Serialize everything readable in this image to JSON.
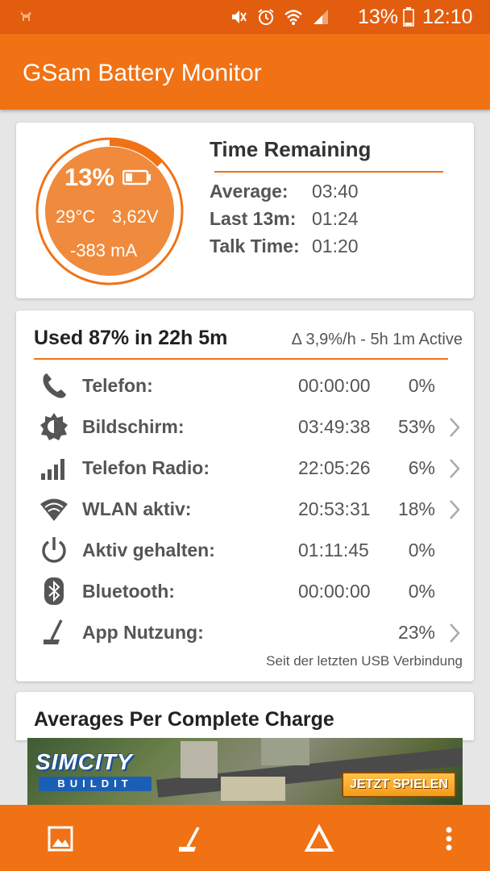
{
  "status_bar": {
    "battery_percent": "13%",
    "time": "12:10",
    "icons": [
      "deer-icon",
      "mute-icon",
      "alarm-icon",
      "wifi-icon",
      "signal-icon",
      "battery-icon"
    ]
  },
  "app": {
    "title": "GSam Battery Monitor"
  },
  "battery_card": {
    "percent": "13%",
    "level_fraction": 0.13,
    "temperature": "29°C",
    "voltage": "3,62V",
    "current": "-383 mA",
    "time_remaining": {
      "title": "Time Remaining",
      "rows": [
        {
          "label": "Average:",
          "value": "03:40"
        },
        {
          "label": "Last 13m:",
          "value": "01:24"
        },
        {
          "label": "Talk Time:",
          "value": "01:20"
        }
      ]
    }
  },
  "usage_card": {
    "title": "Used 87% in 22h 5m",
    "rate": "Δ 3,9%/h - 5h 1m Active",
    "rows": [
      {
        "icon": "phone-icon",
        "label": "Telefon:",
        "time": "00:00:00",
        "percent": "0%",
        "has_detail": false
      },
      {
        "icon": "brightness-icon",
        "label": "Bildschirm:",
        "time": "03:49:38",
        "percent": "53%",
        "has_detail": true
      },
      {
        "icon": "signal-bars-icon",
        "label": "Telefon Radio:",
        "time": "22:05:26",
        "percent": "6%",
        "has_detail": true
      },
      {
        "icon": "wifi-icon",
        "label": "WLAN aktiv:",
        "time": "20:53:31",
        "percent": "18%",
        "has_detail": true
      },
      {
        "icon": "power-icon",
        "label": "Aktiv gehalten:",
        "time": "01:11:45",
        "percent": "0%",
        "has_detail": false
      },
      {
        "icon": "bluetooth-icon",
        "label": "Bluetooth:",
        "time": "00:00:00",
        "percent": "0%",
        "has_detail": false
      },
      {
        "icon": "app-usage-icon",
        "label": "App Nutzung:",
        "time": "",
        "percent": "23%",
        "has_detail": true
      }
    ],
    "footnote": "Seit der letzten USB Verbindung"
  },
  "averages_card": {
    "title": "Averages Per Complete Charge"
  },
  "ad": {
    "logo_line1": "SIMCITY",
    "logo_line2": "BUILDIT",
    "cta": "JETZT SPIELEN"
  },
  "bottom_bar": {
    "icons": [
      "image-icon",
      "app-usage-icon",
      "delta-icon",
      "more-vert-icon"
    ]
  },
  "colors": {
    "status_bar": "#e35d0f",
    "accent": "#f07215",
    "gauge_fill": "#f08a3c",
    "background": "#e6e6e6"
  }
}
